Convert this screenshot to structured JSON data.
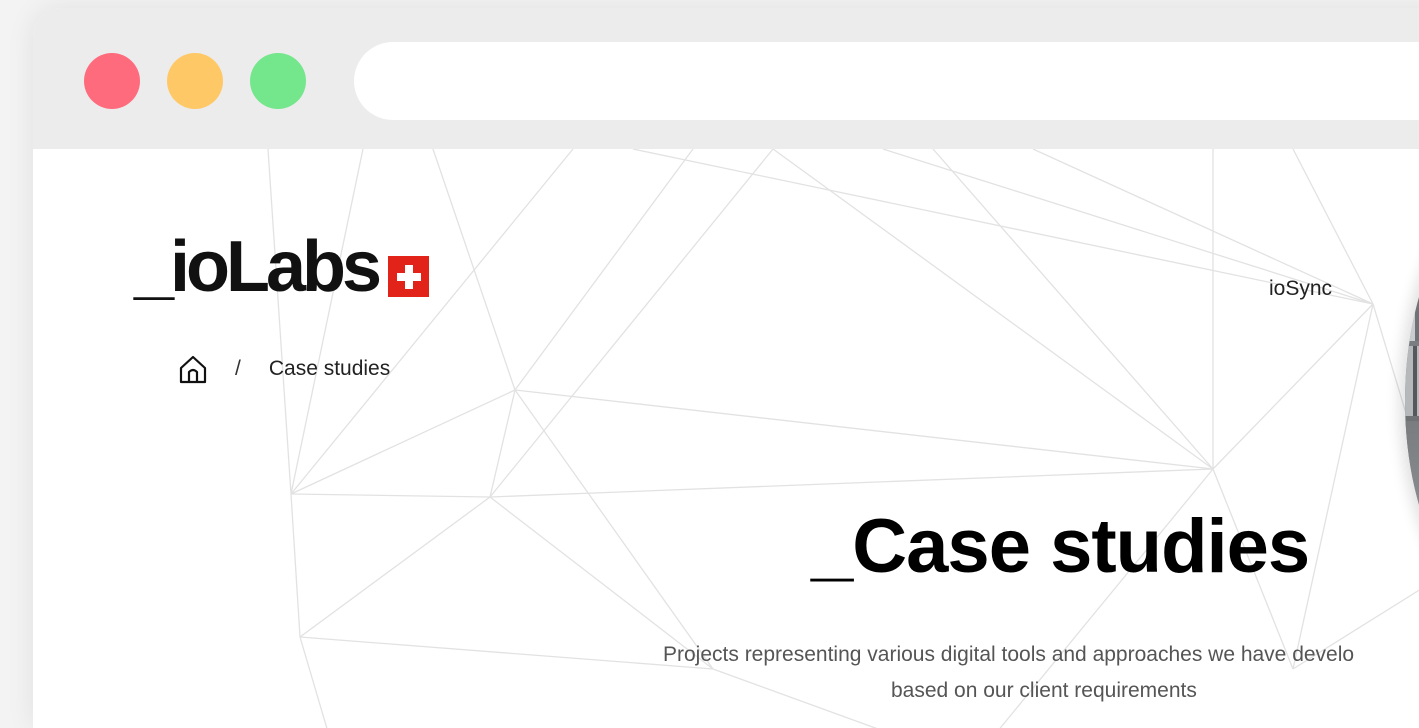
{
  "browser": {
    "window_controls": [
      "close",
      "minimize",
      "maximize"
    ],
    "address_bar_value": ""
  },
  "header": {
    "logo_text": "_ioLabs",
    "logo_badge_icon": "swiss-flag-icon",
    "nav_link": "ioSync"
  },
  "breadcrumb": {
    "home_icon": "home-icon",
    "separator": "/",
    "current": "Case studies"
  },
  "hero": {
    "title": "_Case studies",
    "subtitle_line1": "Projects representing various digital tools and approaches we have develo",
    "subtitle_line2": "based on our client requirements"
  },
  "colors": {
    "close_dot": "#fe6b7d",
    "minimize_dot": "#ffc866",
    "maximize_dot": "#74e68c",
    "flag_red": "#e2231a"
  }
}
